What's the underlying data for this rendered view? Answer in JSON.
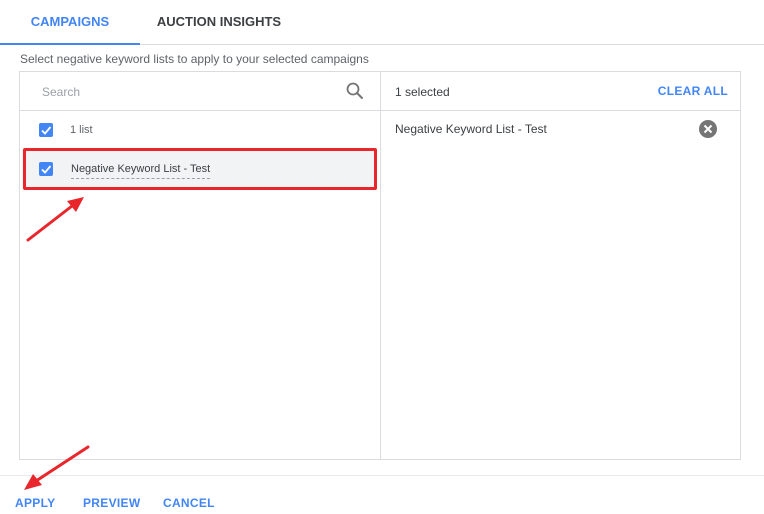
{
  "tabs": [
    {
      "label": "CAMPAIGNS",
      "active": true
    },
    {
      "label": "AUCTION INSIGHTS",
      "active": false
    }
  ],
  "instruction": "Select negative keyword lists to apply to your selected campaigns",
  "search": {
    "placeholder": "Search",
    "value": ""
  },
  "list": {
    "all_label": "1 list",
    "all_checked": true,
    "items": [
      {
        "label": "Negative Keyword List - Test",
        "checked": true
      }
    ]
  },
  "selected": {
    "count_text": "1 selected",
    "clear_all_label": "CLEAR ALL",
    "items": [
      {
        "label": "Negative Keyword List - Test"
      }
    ]
  },
  "footer": {
    "apply_label": "APPLY",
    "preview_label": "PREVIEW",
    "cancel_label": "CANCEL"
  },
  "colors": {
    "accent": "#4285f4",
    "annotation": "#e8262b",
    "selected_row_bg": "#f1f3f4"
  }
}
